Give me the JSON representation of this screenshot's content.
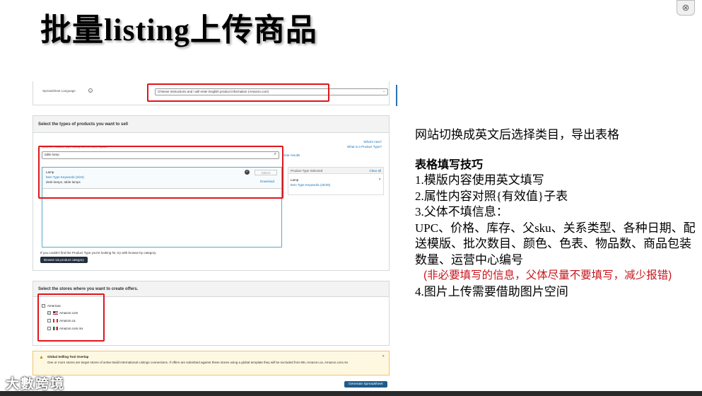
{
  "slide": {
    "title": "批量listing上传商品",
    "close_glyph": "⊗",
    "watermark": "大數跨境"
  },
  "screenshot": {
    "language": {
      "label": "Spreadsheet Language",
      "info_icon": "info-icon",
      "value": "Chinese instructions and I will enter English product information (Amazon.com)"
    },
    "product_types": {
      "header": "Select the types of products you want to sell",
      "whats_new": "What's new?",
      "what_is": "What is a Product Type?",
      "search_hint": "Search Product Type using one or more inputs",
      "search_value": "table lamp",
      "clear_results": "Clear results",
      "result": {
        "name": "Lamp",
        "keywords": "Item Type Keywords (2/23)",
        "examples": "desk-lamps, table-lamps",
        "select_label": "Select",
        "download_label": "Download"
      },
      "selected": {
        "header": "Product Type Selected",
        "clear_all": "Clear all",
        "name": "Lamp",
        "keywords": "Item Type Keywords (25/25)",
        "remove_glyph": "✕"
      },
      "browse_hint": "If you couldn't find the Product Type you're looking for, try with browse by category",
      "browse_button": "Browse via product category"
    },
    "stores": {
      "header": "Select the stores where you want to create offers.",
      "region": "Americas",
      "items": [
        "Amazon.com",
        "Amazon.ca",
        "Amazon.com.mx"
      ]
    },
    "alert": {
      "title": "Global Selling Tool Overlap",
      "text": "One or more stores are target stores of active Build International Listings connections. If offers are submitted against these stores using a global template they will be excluded from BIL:Amazon.ca, Amazon.com.mx",
      "close_glyph": "✕"
    },
    "generate_button": "Generate Spreadsheet"
  },
  "notes": {
    "intro": "网站切换成英文后选择类目，导出表格",
    "heading": "表格填写技巧",
    "lines": [
      "1.模版内容使用英文填写",
      "2.属性内容对照{有效值}子表",
      "3.父体不填信息：",
      "UPC、价格、库存、父sku、关系类型、各种日期、配送模版、批次数目、颜色、色表、物品数、商品包装数量、运营中心编号"
    ],
    "warning": "(非必要填写的信息，父体尽量不要填写，减少报错)",
    "last": "4.图片上传需要借助图片空间"
  },
  "colors": {
    "highlight": "#e0161b",
    "warning_text": "#c8161d",
    "generate_button": "#1f5c8a",
    "alert_bg": "#fff8e1"
  }
}
